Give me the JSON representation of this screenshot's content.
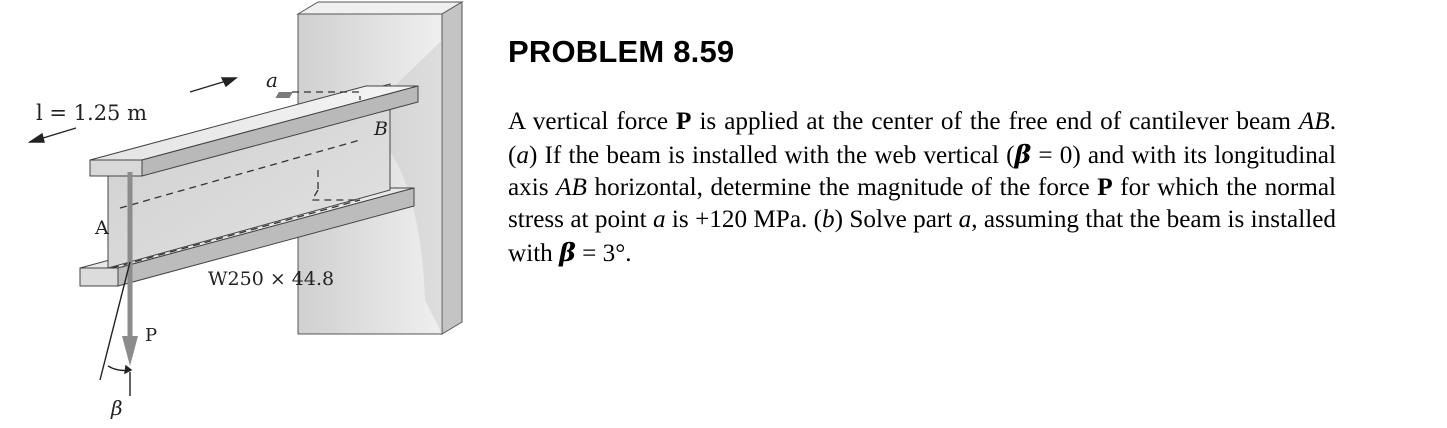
{
  "problem": {
    "title": "PROBLEM 8.59",
    "statement": {
      "s1": "A vertical force ",
      "force_symbol": "P",
      "s2": " is applied at the center of the free end of cantilever beam ",
      "beam_label": "AB",
      "s3": ". (",
      "part_a": "a",
      "s4": ") If the beam is installed with the web vertical (",
      "beta1": "β",
      "s5": " = 0) and with its longitudinal axis ",
      "axis_label": "AB",
      "s6": " horizontal, determine the magnitude of the force ",
      "force_symbol_2": "P",
      "s7": " for which the normal stress at point ",
      "point": "a",
      "s8": " is +120 MPa. (",
      "part_b": "b",
      "s9": ") Solve part ",
      "part_ref": "a",
      "s10": ", assuming that the beam is installed with ",
      "beta2": "β",
      "s11": " = 3°."
    }
  },
  "figure": {
    "length_label": "l = 1.25 m",
    "point_a_label": "a",
    "point_B_label": "B",
    "point_A_label": "A",
    "section_label": "W250 × 44.8",
    "force_label": "P",
    "angle_label": "β",
    "colors": {
      "beam_light": "#ececec",
      "beam_mid": "#d4d4d4",
      "beam_dark": "#b7b7b7",
      "wall_front": "#e6e6e6",
      "wall_side": "#c9c9c9",
      "force_arrow": "#8c8c8c"
    }
  }
}
